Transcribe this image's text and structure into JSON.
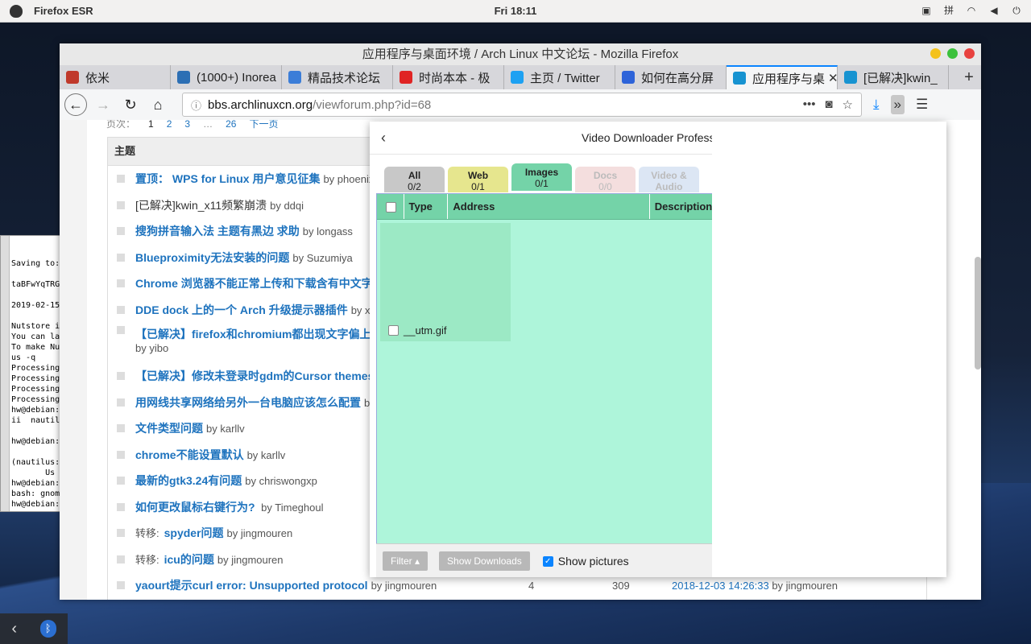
{
  "topbar": {
    "app": "Firefox ESR",
    "clock": "Fri 18:11",
    "tray": [
      "display-icon",
      "input-method",
      "wifi-icon",
      "volume-icon",
      "power-icon"
    ],
    "input_method": "拼"
  },
  "terminal": {
    "lines": [
      "Saving to:",
      "",
      "taBFwYqTRG",
      "",
      "2019-02-15",
      "",
      "Nutstore i",
      "You can la",
      "To make Nu",
      "us -q",
      "Processing",
      "Processing",
      "Processing",
      "Processing",
      "hw@debian:",
      "ii  nautil",
      "",
      "hw@debian:",
      "",
      "(nautilus:",
      "       Us",
      "hw@debian:",
      "bash: gnom",
      "hw@debian:"
    ]
  },
  "window": {
    "title": "应用程序与桌面环境 / Arch Linux 中文论坛 - Mozilla Firefox"
  },
  "tabs": [
    {
      "label": "依米",
      "color": "#c0392b"
    },
    {
      "label": "(1000+) Inorea",
      "color": "#2c6fb4"
    },
    {
      "label": "精品技术论坛",
      "color": "#3b7dd8"
    },
    {
      "label": "时尚本本 - 极",
      "color": "#e02424"
    },
    {
      "label": "主页 / Twitter",
      "color": "#1da1f2"
    },
    {
      "label": "如何在高分屏",
      "color": "#2d63d9"
    },
    {
      "label": "应用程序与桌",
      "color": "#1793d1"
    },
    {
      "label": "[已解决]kwin_",
      "color": "#1793d1"
    }
  ],
  "nav": {
    "url_host": "bbs.archlinuxcn.org",
    "url_path": "/viewforum.php?id=68"
  },
  "forum": {
    "pager": {
      "label": "页次：",
      "pages": [
        "1",
        "2",
        "3",
        "…",
        "26"
      ],
      "next": "下一页"
    },
    "header": "主题",
    "rows": [
      {
        "prefix": "",
        "title": "置顶：  WPS for Linux 用户意见征集",
        "by": "by phoenixlzx"
      },
      {
        "prefix": "",
        "title": "[已解决]kwin_x11频繁崩溃",
        "by": "by ddqi",
        "plain": true
      },
      {
        "prefix": "",
        "title": "搜狗拼音输入法 主题有黑边 求助",
        "by": "by longass"
      },
      {
        "prefix": "",
        "title": "Blueproximity无法安装的问题",
        "by": "by Suzumiya"
      },
      {
        "prefix": "",
        "title": "Chrome 浏览器不能正常上传和下载含有中文字符",
        "by": ""
      },
      {
        "prefix": "",
        "title": "DDE dock 上的一个 Arch 升级提示器插件",
        "by": "by xfzffl"
      },
      {
        "prefix": "",
        "title": "【已解决】firefox和chromium都出现文字偏上的",
        "by": "by yibo",
        "tall": true
      },
      {
        "prefix": "",
        "title": "【已解决】修改未登录时gdm的Cursor themes问",
        "by": ""
      },
      {
        "prefix": "",
        "title": "用网线共享网络给另外一台电脑应该怎么配置",
        "by": "by xu"
      },
      {
        "prefix": "",
        "title": "文件类型问题",
        "by": "by karllv"
      },
      {
        "prefix": "",
        "title": "chrome不能设置默认",
        "by": "by karllv"
      },
      {
        "prefix": "",
        "title": "最新的gtk3.24有问题",
        "by": "by chriswongxp"
      },
      {
        "prefix": "",
        "title": "如何更改鼠标右键行为?",
        "by": "  by Timeghoul"
      },
      {
        "prefix": "转移:",
        "title": "spyder问题",
        "by": "by jingmouren"
      },
      {
        "prefix": "转移:",
        "title": "icu的问题",
        "by": "by jingmouren"
      },
      {
        "prefix": "",
        "title": "yaourt提示curl error: Unsupported protocol",
        "by": "by jingmouren",
        "c1": "4",
        "c2": "309",
        "date": "2018-12-03 14:26:33",
        "lastby": "by jingmouren"
      }
    ]
  },
  "popup": {
    "title": "Video Downloader Professi",
    "tabs": [
      {
        "name": "All",
        "count": "0/2",
        "bg": "#c8c8c8",
        "fg": "#222"
      },
      {
        "name": "Web",
        "count": "0/1",
        "bg": "#e6e68e",
        "fg": "#222"
      },
      {
        "name": "Images",
        "count": "0/1",
        "bg": "#74d3a8",
        "fg": "#222"
      },
      {
        "name": "Docs",
        "count": "0/0",
        "bg": "#f4dede",
        "fg": "#bbb"
      },
      {
        "name": "Video & Audio",
        "count": "0/0",
        "bg": "#dce6f4",
        "fg": "#bbb"
      }
    ],
    "columns": {
      "type": "Type",
      "address": "Address",
      "description": "Description"
    },
    "item": {
      "name": "__utm.gif"
    },
    "footer": {
      "filter": "Filter",
      "show_downloads": "Show Downloads",
      "show_pictures": "Show pictures"
    }
  }
}
